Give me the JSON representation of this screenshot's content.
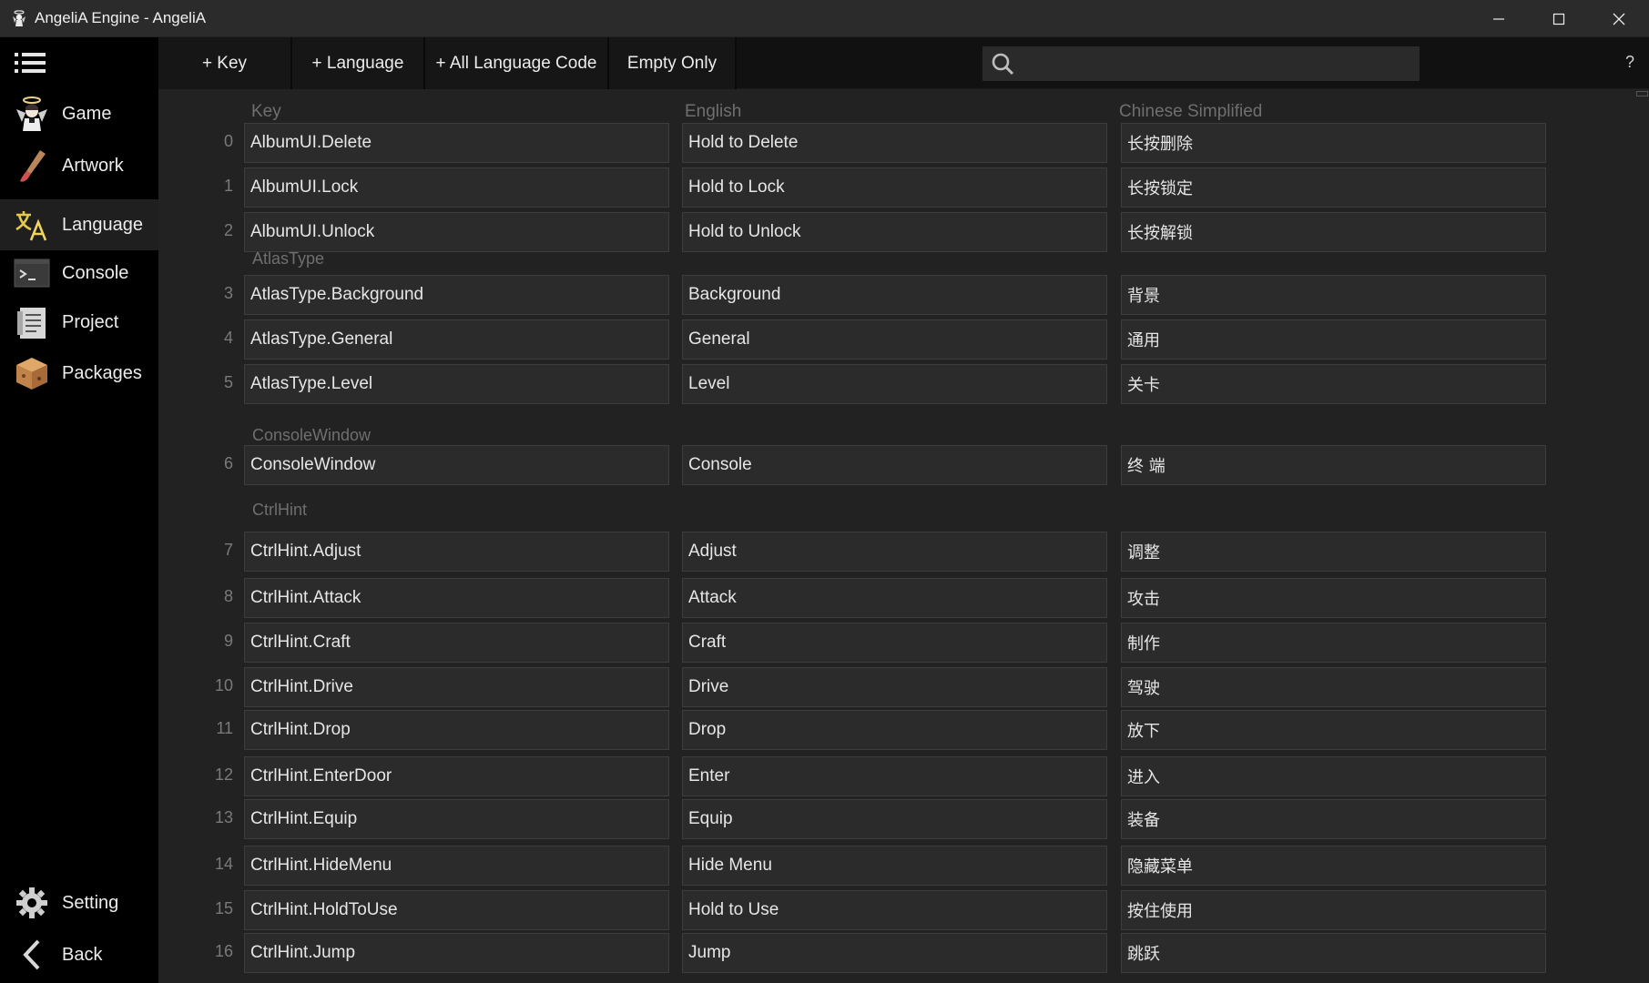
{
  "window": {
    "title": "AngeliA Engine - AngeliA",
    "icon": "angel-icon",
    "controls": [
      "minimize-icon",
      "maximize-icon",
      "close-icon"
    ]
  },
  "sidebar": {
    "menu_icon": "list-menu-icon",
    "items": [
      {
        "label": "Game",
        "icon": "angel-character-icon"
      },
      {
        "label": "Artwork",
        "icon": "paintbrush-icon"
      },
      {
        "label": "Language",
        "icon": "translate-icon",
        "active": true
      },
      {
        "label": "Console",
        "icon": "terminal-icon"
      },
      {
        "label": "Project",
        "icon": "document-icon"
      },
      {
        "label": "Packages",
        "icon": "package-box-icon"
      }
    ],
    "bottom": [
      {
        "label": "Setting",
        "icon": "gear-icon"
      },
      {
        "label": "Back",
        "icon": "chevron-left-icon"
      }
    ]
  },
  "toolbar": {
    "add_key": "+ Key",
    "add_language": "+ Language",
    "add_all_codes": "+ All Language Code",
    "empty_only": "Empty Only",
    "search_placeholder": "",
    "help": "?"
  },
  "table": {
    "headers": {
      "key": "Key",
      "english": "English",
      "chinese": "Chinese Simplified"
    },
    "rows": [
      {
        "index": "0",
        "key": "AlbumUI.Delete",
        "en": "Hold to Delete",
        "zh": "长按删除"
      },
      {
        "index": "1",
        "key": "AlbumUI.Lock",
        "en": "Hold to Lock",
        "zh": "长按锁定"
      },
      {
        "index": "2",
        "key": "AlbumUI.Unlock",
        "en": "Hold to Unlock",
        "zh": "长按解锁"
      },
      {
        "group": "AtlasType"
      },
      {
        "index": "3",
        "key": "AtlasType.Background",
        "en": "Background",
        "zh": "背景"
      },
      {
        "index": "4",
        "key": "AtlasType.General",
        "en": "General",
        "zh": "通用"
      },
      {
        "index": "5",
        "key": "AtlasType.Level",
        "en": "Level",
        "zh": "关卡"
      },
      {
        "group": "ConsoleWindow"
      },
      {
        "index": "6",
        "key": "ConsoleWindow",
        "en": "Console",
        "zh": "终 端"
      },
      {
        "group": "CtrlHint"
      },
      {
        "index": "7",
        "key": "CtrlHint.Adjust",
        "en": "Adjust",
        "zh": "调整"
      },
      {
        "index": "8",
        "key": "CtrlHint.Attack",
        "en": "Attack",
        "zh": "攻击"
      },
      {
        "index": "9",
        "key": "CtrlHint.Craft",
        "en": "Craft",
        "zh": "制作"
      },
      {
        "index": "10",
        "key": "CtrlHint.Drive",
        "en": "Drive",
        "zh": "驾驶"
      },
      {
        "index": "11",
        "key": "CtrlHint.Drop",
        "en": "Drop",
        "zh": "放下"
      },
      {
        "index": "12",
        "key": "CtrlHint.EnterDoor",
        "en": "Enter",
        "zh": "进入"
      },
      {
        "index": "13",
        "key": "CtrlHint.Equip",
        "en": "Equip",
        "zh": "装备"
      },
      {
        "index": "14",
        "key": "CtrlHint.HideMenu",
        "en": "Hide Menu",
        "zh": "隐藏菜单"
      },
      {
        "index": "15",
        "key": "CtrlHint.HoldToUse",
        "en": "Hold to Use",
        "zh": "按住使用"
      },
      {
        "index": "16",
        "key": "CtrlHint.Jump",
        "en": "Jump",
        "zh": "跳跃"
      }
    ]
  }
}
